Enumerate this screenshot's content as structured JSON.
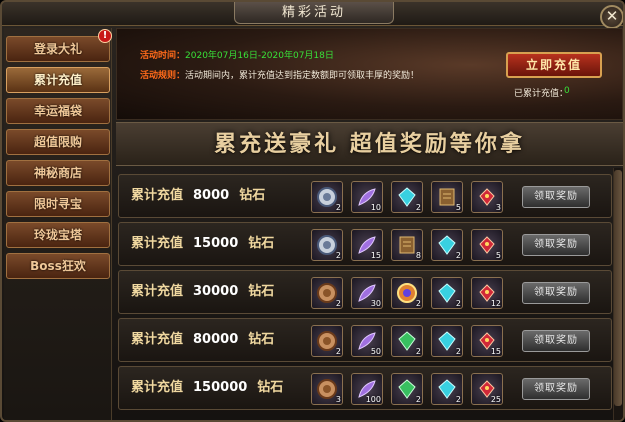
{
  "window": {
    "title": "精彩活动",
    "close_label": "✕"
  },
  "sidebar": {
    "badge": "!",
    "items": [
      {
        "label": "登录大礼",
        "active": false
      },
      {
        "label": "累计充值",
        "active": true
      },
      {
        "label": "幸运福袋",
        "active": false
      },
      {
        "label": "超值限购",
        "active": false
      },
      {
        "label": "神秘商店",
        "active": false
      },
      {
        "label": "限时寻宝",
        "active": false
      },
      {
        "label": "玲珑宝塔",
        "active": false
      },
      {
        "label": "Boss狂欢",
        "active": false
      }
    ]
  },
  "banner": {
    "time_key": "活动时间：",
    "time_value": "2020年07月16日-2020年07月18日",
    "rule_key": "活动规则：",
    "rule_value": "活动期间内，累计充值达到指定数额即可领取丰厚的奖励！",
    "recharge_button": "立即充值",
    "total_label": "已累计充值：",
    "total_value": "0"
  },
  "slogan": "累充送豪礼   超值奖励等你拿",
  "tiers": [
    {
      "prefix": "累计充值",
      "amount": "8000",
      "unit": "钻石",
      "items": [
        {
          "icon": "silver-coin-icon",
          "count": "2"
        },
        {
          "icon": "feather-icon",
          "count": "10"
        },
        {
          "icon": "cyan-gem-icon",
          "count": "2"
        },
        {
          "icon": "scroll-book-icon",
          "count": "5"
        },
        {
          "icon": "red-gem-icon",
          "count": "3"
        }
      ]
    },
    {
      "prefix": "累计充值",
      "amount": "15000",
      "unit": "钻石",
      "items": [
        {
          "icon": "silver-coin-icon",
          "count": "2"
        },
        {
          "icon": "feather-icon",
          "count": "15"
        },
        {
          "icon": "scroll-book-icon",
          "count": "8"
        },
        {
          "icon": "cyan-gem-icon",
          "count": "2"
        },
        {
          "icon": "red-gem-icon",
          "count": "5"
        }
      ]
    },
    {
      "prefix": "累计充值",
      "amount": "30000",
      "unit": "钻石",
      "items": [
        {
          "icon": "bronze-medal-icon",
          "count": "2"
        },
        {
          "icon": "feather-icon",
          "count": "30"
        },
        {
          "icon": "rainbow-orb-icon",
          "count": "2"
        },
        {
          "icon": "cyan-gem-icon",
          "count": "2"
        },
        {
          "icon": "red-gem-icon",
          "count": "12"
        }
      ]
    },
    {
      "prefix": "累计充值",
      "amount": "80000",
      "unit": "钻石",
      "items": [
        {
          "icon": "bronze-medal-icon",
          "count": "2"
        },
        {
          "icon": "feather-icon",
          "count": "50"
        },
        {
          "icon": "green-gem-icon",
          "count": "2"
        },
        {
          "icon": "cyan-gem-icon",
          "count": "2"
        },
        {
          "icon": "red-gem-icon",
          "count": "15"
        }
      ]
    },
    {
      "prefix": "累计充值",
      "amount": "150000",
      "unit": "钻石",
      "items": [
        {
          "icon": "bronze-medal-icon",
          "count": "3"
        },
        {
          "icon": "feather-icon",
          "count": "100"
        },
        {
          "icon": "green-gem-icon",
          "count": "2"
        },
        {
          "icon": "cyan-gem-icon",
          "count": "2"
        },
        {
          "icon": "red-gem-icon",
          "count": "25"
        }
      ]
    }
  ],
  "claim_label": "领取奖励"
}
